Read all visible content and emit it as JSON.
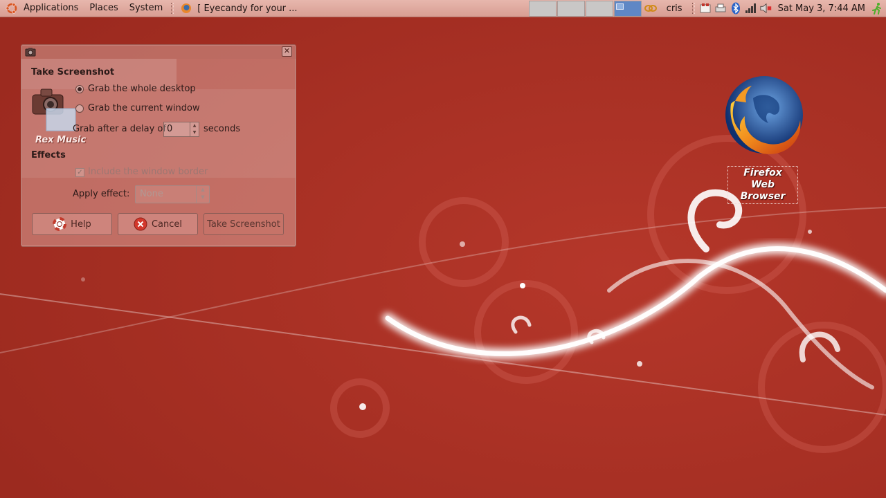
{
  "top_panel": {
    "menus": [
      "Applications",
      "Places",
      "System"
    ],
    "task_title": "[ Eyecandy for your ...",
    "user": "cris",
    "clock": "Sat May  3,  7:44 AM",
    "workspaces": 4,
    "active_workspace": 4
  },
  "desktop": {
    "firefox_label": "Firefox Web Browser"
  },
  "dialog": {
    "heading": "Take Screenshot",
    "option_whole": "Grab the whole desktop",
    "option_window": "Grab the current window",
    "delay_prefix": "Grab after a delay of",
    "delay_value": "0",
    "delay_suffix": "seconds",
    "effects_heading": "Effects",
    "include_border": "Include the window border",
    "apply_effect_label": "Apply effect:",
    "apply_effect_value": "None",
    "help_button": "Help",
    "cancel_button": "Cancel",
    "take_button": "Take Screenshot",
    "overlay_app_label": "Rex Music",
    "selected_option": "whole-desktop",
    "include_border_checked": true
  },
  "colors": {
    "wallpaper": "#a32c20",
    "panel": "#e0aaa0",
    "active_workspace": "#5f87c5"
  }
}
